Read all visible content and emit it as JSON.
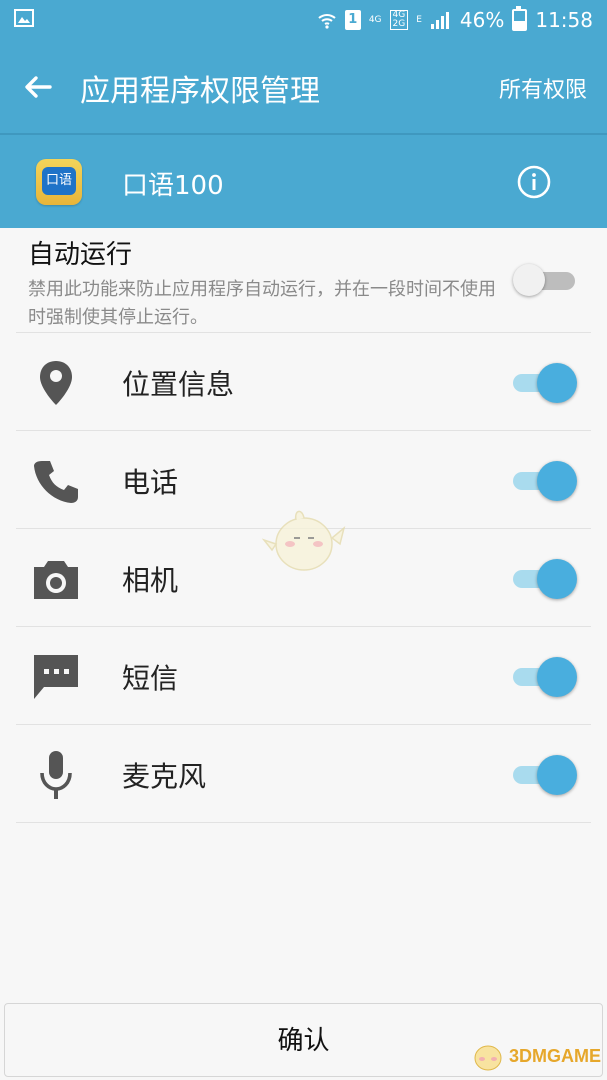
{
  "status_bar": {
    "sim_slot": "1",
    "net_4g": "4G",
    "net_4g_2g_top": "4G",
    "net_4g_2g_bottom": "2G",
    "net_e": "E",
    "battery_percent": "46%",
    "battery_level": 0.46,
    "time": "11:58"
  },
  "header": {
    "title": "应用程序权限管理",
    "all_permissions": "所有权限"
  },
  "app": {
    "name": "口语100",
    "icon_text": "口语"
  },
  "autorun": {
    "title": "自动运行",
    "description": "禁用此功能来防止应用程序自动运行，并在一段时间不使用时强制使其停止运行。",
    "enabled": false
  },
  "permissions": [
    {
      "label": "位置信息",
      "icon": "location-icon",
      "enabled": true
    },
    {
      "label": "电话",
      "icon": "phone-icon",
      "enabled": true
    },
    {
      "label": "相机",
      "icon": "camera-icon",
      "enabled": true
    },
    {
      "label": "短信",
      "icon": "sms-icon",
      "enabled": true
    },
    {
      "label": "麦克风",
      "icon": "microphone-icon",
      "enabled": true
    }
  ],
  "confirm_label": "确认",
  "watermark_text": "3DMGAME",
  "colors": {
    "header": "#4aa9d1",
    "switch_on": "#49aede",
    "switch_track_on": "#a9dbee",
    "switch_off": "#bdbdbd"
  }
}
